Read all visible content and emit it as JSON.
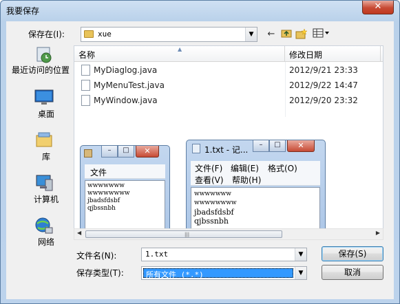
{
  "window": {
    "title": "我要保存",
    "close_label": "✕"
  },
  "toolbar": {
    "save_in_label": "保存在(I):",
    "current_folder": "xue",
    "back_icon": "back-arrow-icon",
    "up_icon": "up-folder-icon",
    "new_folder_icon": "new-folder-icon",
    "view_icon": "view-menu-icon"
  },
  "places": [
    {
      "label": "最近访问的位置",
      "icon": "recent-places-icon"
    },
    {
      "label": "桌面",
      "icon": "desktop-icon"
    },
    {
      "label": "库",
      "icon": "libraries-icon"
    },
    {
      "label": "计算机",
      "icon": "computer-icon"
    },
    {
      "label": "网络",
      "icon": "network-icon"
    }
  ],
  "file_list": {
    "columns": [
      "名称",
      "修改日期"
    ],
    "files": [
      {
        "name": "MyDiaglog.java",
        "date": "2012/9/21 23:33"
      },
      {
        "name": "MyMenuTest.java",
        "date": "2012/9/22 14:47"
      },
      {
        "name": "MyWindow.java",
        "date": "2012/9/20 23:32"
      }
    ]
  },
  "overlay_small": {
    "menu": "文件",
    "lines": [
      "wwwwwww",
      "wwwwwwww",
      "jbadsfdsbf",
      "qjbssnbh"
    ]
  },
  "overlay_notepad": {
    "title": "1.txt - 记...",
    "menus": [
      "文件(F)",
      "编辑(E)",
      "格式(O)",
      "查看(V)",
      "帮助(H)"
    ],
    "lines": [
      "wwwwwww",
      "wwwwwwww",
      "jbadsfdsbf",
      "qjbssnbh"
    ]
  },
  "form": {
    "file_name_label": "文件名(N):",
    "file_name_value": "1.txt",
    "file_type_label": "保存类型(T):",
    "file_type_value": "所有文件 (*.*)"
  },
  "buttons": {
    "save": "保存(S)",
    "cancel": "取消"
  }
}
